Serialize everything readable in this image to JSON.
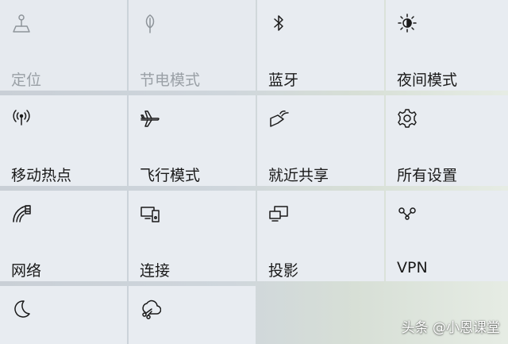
{
  "tiles": [
    {
      "label": "定位",
      "icon": "location-icon",
      "state": "disabled"
    },
    {
      "label": "节电模式",
      "icon": "leaf-icon",
      "state": "disabled"
    },
    {
      "label": "蓝牙",
      "icon": "bluetooth-icon",
      "state": "enabled"
    },
    {
      "label": "夜间模式",
      "icon": "brightness-icon",
      "state": "enabled"
    },
    {
      "label": "移动热点",
      "icon": "hotspot-icon",
      "state": "enabled"
    },
    {
      "label": "飞行模式",
      "icon": "airplane-icon",
      "state": "enabled"
    },
    {
      "label": "就近共享",
      "icon": "nearby-share-icon",
      "state": "enabled"
    },
    {
      "label": "所有设置",
      "icon": "gear-icon",
      "state": "enabled"
    },
    {
      "label": "网络",
      "icon": "network-icon",
      "state": "enabled"
    },
    {
      "label": "连接",
      "icon": "connect-icon",
      "state": "enabled"
    },
    {
      "label": "投影",
      "icon": "project-icon",
      "state": "enabled"
    },
    {
      "label": "VPN",
      "icon": "vpn-icon",
      "state": "enabled"
    },
    {
      "label": "",
      "icon": "moon-icon",
      "state": "enabled"
    },
    {
      "label": "",
      "icon": "snip-icon",
      "state": "enabled"
    }
  ],
  "watermark": "头条 @小恩课堂",
  "colors": {
    "tile": "#e8ecf1",
    "text": "#1a1a1a",
    "dimText": "#9aa0a6"
  }
}
